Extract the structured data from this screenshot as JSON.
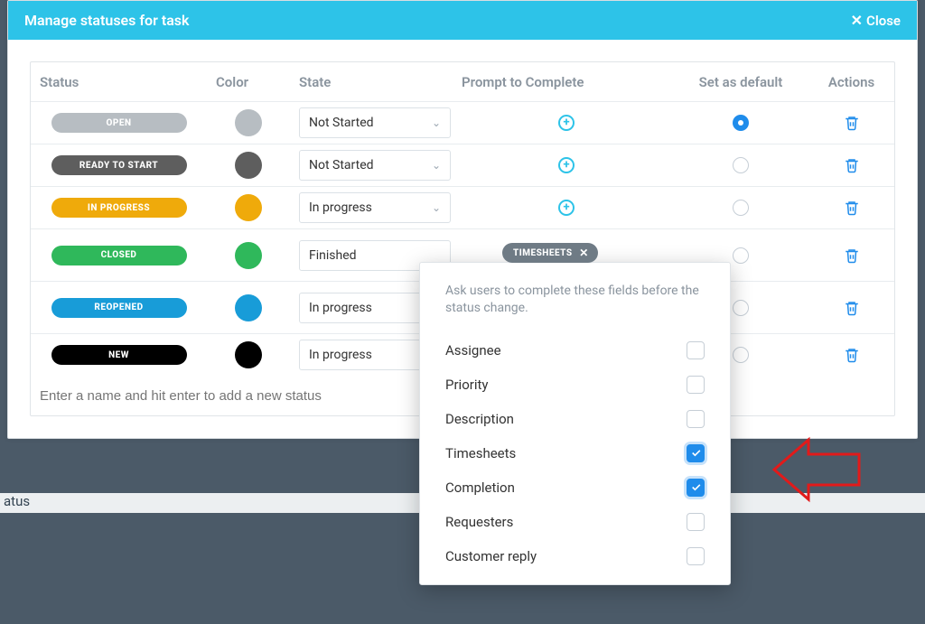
{
  "modal": {
    "title": "Manage statuses for task",
    "close_label": "Close"
  },
  "columns": {
    "status": "Status",
    "color": "Color",
    "state": "State",
    "prompt": "Prompt to Complete",
    "setdefault": "Set as default",
    "actions": "Actions"
  },
  "rows": [
    {
      "name": "OPEN",
      "pill_color": "#b7bdc2",
      "dot_color": "#b7bdc2",
      "state": "Not Started",
      "chevron": true,
      "show_plus": true,
      "default": true
    },
    {
      "name": "READY TO START",
      "pill_color": "#5e5e5e",
      "dot_color": "#5e5e5e",
      "state": "Not Started",
      "chevron": true,
      "show_plus": true,
      "default": false
    },
    {
      "name": "IN PROGRESS",
      "pill_color": "#efaa0b",
      "dot_color": "#efaa0b",
      "state": "In progress",
      "chevron": true,
      "show_plus": true,
      "default": false
    },
    {
      "name": "CLOSED",
      "pill_color": "#2fb85b",
      "dot_color": "#2fb85b",
      "state": "Finished",
      "chevron": false,
      "show_plus": false,
      "default": false
    },
    {
      "name": "REOPENED",
      "pill_color": "#189cd8",
      "dot_color": "#189cd8",
      "state": "In progress",
      "chevron": false,
      "show_plus": false,
      "default": false
    },
    {
      "name": "NEW",
      "pill_color": "#000000",
      "dot_color": "#000000",
      "state": "In progress",
      "chevron": false,
      "show_plus": false,
      "default": false
    }
  ],
  "addrow": {
    "placeholder": "Enter a name and hit enter to add a new status"
  },
  "tag": {
    "label": "TIMESHEETS"
  },
  "popover": {
    "description": "Ask users to complete these fields before the status change.",
    "items": [
      {
        "label": "Assignee",
        "checked": false
      },
      {
        "label": "Priority",
        "checked": false
      },
      {
        "label": "Description",
        "checked": false
      },
      {
        "label": "Timesheets",
        "checked": true
      },
      {
        "label": "Completion",
        "checked": true
      },
      {
        "label": "Requesters",
        "checked": false
      },
      {
        "label": "Customer reply",
        "checked": false
      }
    ]
  },
  "bg": {
    "text": "atus"
  }
}
